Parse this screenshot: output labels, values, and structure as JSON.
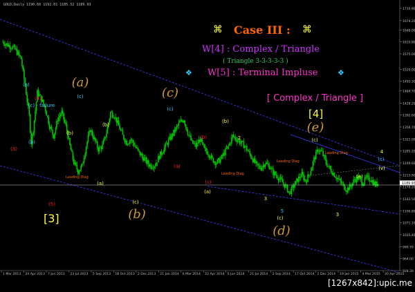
{
  "window": {
    "symbol_line": "GOLD,Daily  1190.60 1192.61 1185.52 1189.93"
  },
  "watermark": "[1267x842]:upic.me",
  "annotations": {
    "case_title": "Case III :",
    "case_symbol": "⌘",
    "wave4": "W[4] : Complex / Triangle",
    "wave4_sub": "( Triangle 3-3-3-3-3 )",
    "wave5": "W[5] : Terminal Impluse",
    "diamond": "❖",
    "box_label": "[ Complex / Triangle ]",
    "label_4": "[4]",
    "label_3": "[3]"
  },
  "colors": {
    "background": "#000000",
    "candle": "#00c800",
    "channel": "#3c3cff",
    "axis_text": "#c0c0c0",
    "accent_yellow": "#ffff33",
    "accent_orange": "#ff6600",
    "accent_purple": "#cc33ff",
    "accent_magenta": "#ff33cc",
    "accent_cyan": "#33ccff",
    "wave_red": "#ff2222",
    "wave_gold": "#cc9933"
  },
  "chart_data": {
    "type": "candlestick",
    "instrument": "GOLD",
    "timeframe": "Daily",
    "last_ohlc": {
      "open": 1190.6,
      "high": 1192.61,
      "low": 1185.52,
      "close": 1189.93
    },
    "x_tick_labels": [
      "1 Mar 2013",
      "24 Apr 2013",
      "7 Jun 2013",
      "23 Jul 2013",
      "5 Sep 2013",
      "18 Oct 2013",
      "2 Dec 2013",
      "21 Jan 2014",
      "6 Mar 2014",
      "22 Apr 2014",
      "5 Jun 2014",
      "21 Jul 2014",
      "3 Sep 2014",
      "17 Oct 2014",
      "2 Dec 2014",
      "19 Jan 2015",
      "4 Mar 2015",
      "20 Apr 2015"
    ],
    "y_tick_labels": [
      "1710.90",
      "1674.20",
      "1646.00",
      "1610.80",
      "1575.00",
      "1529.00",
      "1493.30",
      "1464.70",
      "1428.20",
      "1392.60",
      "1356.70",
      "1321.00",
      "1285.20",
      "1249.60",
      "1213.90",
      "1178.20",
      "1142.50",
      "1106.80",
      "1071.10",
      "1035.40",
      "999.70",
      "964.00",
      "928.30"
    ],
    "ylim": [
      928.3,
      1710.9
    ],
    "current_price": "1189.93",
    "close_path": [
      [
        0,
        1610
      ],
      [
        3,
        1600
      ],
      [
        5,
        1595
      ],
      [
        7,
        1580
      ],
      [
        9,
        1560
      ],
      [
        11,
        1480
      ],
      [
        13,
        1390
      ],
      [
        14,
        1310
      ],
      [
        15,
        1350
      ],
      [
        17,
        1460
      ],
      [
        19,
        1440
      ],
      [
        21,
        1410
      ],
      [
        23,
        1360
      ],
      [
        25,
        1330
      ],
      [
        27,
        1380
      ],
      [
        29,
        1400
      ],
      [
        31,
        1360
      ],
      [
        33,
        1300
      ],
      [
        35,
        1250
      ],
      [
        37,
        1225
      ],
      [
        39,
        1240
      ],
      [
        41,
        1300
      ],
      [
        43,
        1350
      ],
      [
        45,
        1320
      ],
      [
        47,
        1290
      ],
      [
        49,
        1300
      ],
      [
        51,
        1340
      ],
      [
        53,
        1400
      ],
      [
        55,
        1390
      ],
      [
        57,
        1360
      ],
      [
        59,
        1330
      ],
      [
        61,
        1310
      ],
      [
        63,
        1320
      ],
      [
        65,
        1300
      ],
      [
        67,
        1280
      ],
      [
        69,
        1265
      ],
      [
        71,
        1250
      ],
      [
        73,
        1240
      ],
      [
        75,
        1245
      ],
      [
        77,
        1270
      ],
      [
        79,
        1290
      ],
      [
        81,
        1310
      ],
      [
        83,
        1330
      ],
      [
        85,
        1350
      ],
      [
        87,
        1370
      ],
      [
        89,
        1380
      ],
      [
        91,
        1340
      ],
      [
        93,
        1310
      ],
      [
        95,
        1300
      ],
      [
        97,
        1320
      ],
      [
        99,
        1290
      ],
      [
        101,
        1280
      ],
      [
        103,
        1260
      ],
      [
        105,
        1250
      ],
      [
        107,
        1260
      ],
      [
        109,
        1280
      ],
      [
        111,
        1300
      ],
      [
        113,
        1330
      ],
      [
        115,
        1320
      ],
      [
        117,
        1310
      ],
      [
        119,
        1300
      ],
      [
        121,
        1280
      ],
      [
        123,
        1260
      ],
      [
        125,
        1240
      ],
      [
        127,
        1235
      ],
      [
        129,
        1250
      ],
      [
        131,
        1240
      ],
      [
        133,
        1220
      ],
      [
        135,
        1210
      ],
      [
        137,
        1195
      ],
      [
        139,
        1180
      ],
      [
        141,
        1160
      ],
      [
        143,
        1180
      ],
      [
        145,
        1200
      ],
      [
        147,
        1215
      ],
      [
        149,
        1195
      ],
      [
        151,
        1220
      ],
      [
        153,
        1260
      ],
      [
        155,
        1290
      ],
      [
        157,
        1280
      ],
      [
        159,
        1250
      ],
      [
        161,
        1230
      ],
      [
        163,
        1215
      ],
      [
        165,
        1200
      ],
      [
        167,
        1185
      ],
      [
        169,
        1170
      ],
      [
        171,
        1180
      ],
      [
        173,
        1200
      ],
      [
        175,
        1205
      ],
      [
        177,
        1190
      ],
      [
        179,
        1205
      ],
      [
        181,
        1200
      ],
      [
        183,
        1185
      ],
      [
        185,
        1190
      ]
    ]
  },
  "wave_labels": [
    {
      "text": "(3)",
      "x": 20,
      "y": 218,
      "color": "#ff2222"
    },
    {
      "text": "(4)",
      "x": 55,
      "y": 145,
      "color": "#ff2222"
    },
    {
      "text": "(5)",
      "x": 75,
      "y": 298,
      "color": "#ff2222"
    },
    {
      "text": "(a)",
      "x": 38,
      "y": 125,
      "color": "#33ccff"
    },
    {
      "text": "(c) - failure",
      "x": 60,
      "y": 155,
      "color": "#33ccff"
    },
    {
      "text": "(b)",
      "x": 46,
      "y": 208,
      "color": "#33ccff"
    },
    {
      "text": "(c)",
      "x": 116,
      "y": 142,
      "color": "#33ccff"
    },
    {
      "text": "(b)",
      "x": 153,
      "y": 183,
      "color": "#ffff33"
    },
    {
      "text": "(a)",
      "x": 145,
      "y": 268,
      "color": "#ffff33"
    },
    {
      "text": "(c)",
      "x": 246,
      "y": 160,
      "color": "#33ccff"
    },
    {
      "text": "(b)",
      "x": 326,
      "y": 178,
      "color": "#ffff33"
    },
    {
      "text": "(a)",
      "x": 300,
      "y": 280,
      "color": "#ffff33"
    },
    {
      "text": "(c)",
      "x": 196,
      "y": 295,
      "color": "#ffff33"
    },
    {
      "text": "(c)",
      "x": 405,
      "y": 318,
      "color": "#ffff33"
    },
    {
      "text": "(c)",
      "x": 455,
      "y": 205,
      "color": "#ffff33"
    },
    {
      "text": "(e)",
      "x": 520,
      "y": 258,
      "color": "#ffff33"
    },
    {
      "text": "2",
      "x": 346,
      "y": 202,
      "color": "#ffff33"
    },
    {
      "text": "4",
      "x": 552,
      "y": 222,
      "color": "#ffff33"
    },
    {
      "text": "3",
      "x": 384,
      "y": 290,
      "color": "#ffff33"
    },
    {
      "text": "3",
      "x": 488,
      "y": 313,
      "color": "#ffff33"
    },
    {
      "text": "5",
      "x": 408,
      "y": 308,
      "color": "#33ccff"
    },
    {
      "text": "(c)",
      "x": 551,
      "y": 233,
      "color": "#33ccff"
    },
    {
      "text": "(v)",
      "x": 552,
      "y": 246,
      "color": "#ffff33"
    },
    {
      "text": "(b)",
      "x": 101,
      "y": 195,
      "color": "#ffff33"
    },
    {
      "text": "(b)",
      "x": 294,
      "y": 201,
      "color": "#ff2222"
    },
    {
      "text": "(a)",
      "x": 256,
      "y": 243,
      "color": "#ff2222"
    },
    {
      "text": "(c)",
      "x": 301,
      "y": 266,
      "color": "#ff2222"
    }
  ],
  "italic_labels": [
    {
      "text": "(a)",
      "x": 116,
      "y": 125
    },
    {
      "text": "(c)",
      "x": 246,
      "y": 140
    },
    {
      "text": "(e)",
      "x": 456,
      "y": 190
    },
    {
      "text": "(d)",
      "x": 407,
      "y": 340
    },
    {
      "text": "(b)",
      "x": 198,
      "y": 316
    }
  ],
  "small_notes": [
    {
      "text": "Leading Diag",
      "x": 95,
      "y": 258,
      "color": "#ff6600"
    },
    {
      "text": "Leading Diag",
      "x": 400,
      "y": 235,
      "color": "#ff6600"
    },
    {
      "text": "Leading Diag",
      "x": 320,
      "y": 253,
      "color": "#ff6600"
    },
    {
      "text": "Leading Diag",
      "x": 470,
      "y": 223,
      "color": "#ff6600"
    }
  ]
}
